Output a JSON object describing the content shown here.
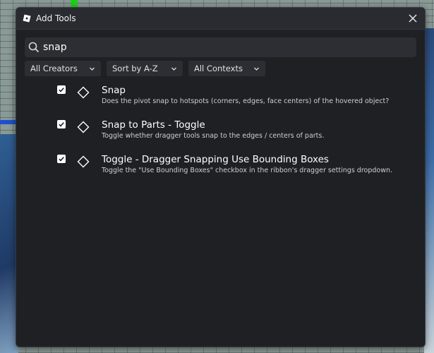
{
  "window": {
    "title": "Add Tools",
    "logo_icon": "roblox-studio-logo-icon",
    "close_icon": "close-icon"
  },
  "search": {
    "value": "snap",
    "icon": "search-icon"
  },
  "filters": {
    "creators": "All Creators",
    "sort": "Sort by A-Z",
    "contexts": "All Contexts"
  },
  "results": [
    {
      "title": "Snap",
      "description": "Does the pivot snap to hotspots (corners, edges, face centers) of the hovered object?",
      "checked": true,
      "icon": "diamond-icon"
    },
    {
      "title": "Snap to Parts - Toggle",
      "description": "Toggle whether dragger tools snap to the edges / centers of parts.",
      "checked": true,
      "icon": "diamond-icon"
    },
    {
      "title": "Toggle - Dragger Snapping Use Bounding Boxes",
      "description": "Toggle the \"Use Bounding Boxes\" checkbox in the ribbon's dragger settings dropdown.",
      "checked": true,
      "icon": "diamond-icon"
    }
  ],
  "colors": {
    "dialog_bg": "#1f2024",
    "titlebar_bg": "#2a2b30",
    "control_bg": "#2d2e33",
    "text": "#ffffff"
  }
}
